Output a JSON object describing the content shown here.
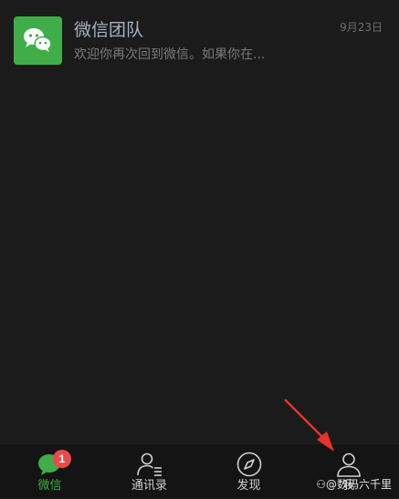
{
  "chat_list": {
    "items": [
      {
        "name": "微信团队",
        "preview": "欢迎你再次回到微信。如果你在...",
        "time": "9月23日",
        "avatar_icon": "wechat-logo-icon"
      }
    ]
  },
  "tabbar": {
    "tabs": [
      {
        "label": "微信",
        "icon": "chat-bubbles-icon",
        "active": true,
        "badge": "1"
      },
      {
        "label": "通讯录",
        "icon": "contacts-icon",
        "active": false
      },
      {
        "label": "发现",
        "icon": "compass-icon",
        "active": false
      },
      {
        "label": "我",
        "icon": "person-icon",
        "active": false
      }
    ]
  },
  "watermark": "⚇@数码六千里",
  "annotation": {
    "color": "#e8322d"
  },
  "colors": {
    "background": "#1b1b1b",
    "accent": "#3fae48",
    "badge": "#e94b4b"
  }
}
